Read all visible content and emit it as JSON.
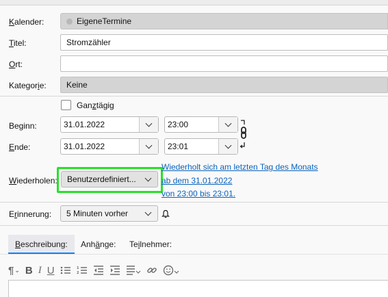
{
  "labels": {
    "kalender": "alender:",
    "kalender_accel": "K",
    "titel": "itel:",
    "titel_accel": "T",
    "ort": "rt:",
    "ort_accel": "O",
    "kategorie_pre": "Kategor",
    "kategorie_accel": "i",
    "kategorie_post": "e:",
    "beginn": "Beginn:",
    "ende_accel": "E",
    "ende": "nde:",
    "wiederholen_accel": "W",
    "wiederholen": "iederholen:",
    "erinnerung_pre": "E",
    "erinnerung_accel": "r",
    "erinnerung_post": "innerung:"
  },
  "fields": {
    "kalender_value": "EigeneTermine",
    "titel_value": "Stromzähler",
    "ort_value": "",
    "kategorie_value": "Keine",
    "ganztaegig_pre": "Gan",
    "ganztaegig_accel": "z",
    "ganztaegig_post": "tägig",
    "ganztaegig_checked": false,
    "beginn_date": "31.01.2022",
    "beginn_time": "23:00",
    "ende_date": "31.01.2022",
    "ende_time": "23:01",
    "wiederholen_value": "Benutzerdefiniert...",
    "erinnerung_value": "5 Minuten vorher"
  },
  "recurrence": {
    "line1": "Wiederholt sich am letzten Tag des Monats",
    "line2": "ab dem 31.01.2022",
    "line3": "von 23:00 bis 23:01."
  },
  "tabs": [
    {
      "pre": "",
      "accel": "B",
      "post": "eschreibung:",
      "active": true
    },
    {
      "pre": "Anh",
      "accel": "ä",
      "post": "nge:",
      "active": false
    },
    {
      "pre": "Te",
      "accel": "i",
      "post": "lnehmer:",
      "active": false
    }
  ],
  "toolbar_icons": [
    "paragraph-format-icon",
    "bold-icon",
    "italic-icon",
    "underline-icon",
    "bulleted-list-icon",
    "numbered-list-icon",
    "outdent-icon",
    "indent-icon",
    "align-icon",
    "insert-link-icon",
    "emoji-icon"
  ],
  "colors": {
    "highlight": "#27e127",
    "link": "#0b63ba",
    "active_tab_underline": "#0a84ff"
  }
}
